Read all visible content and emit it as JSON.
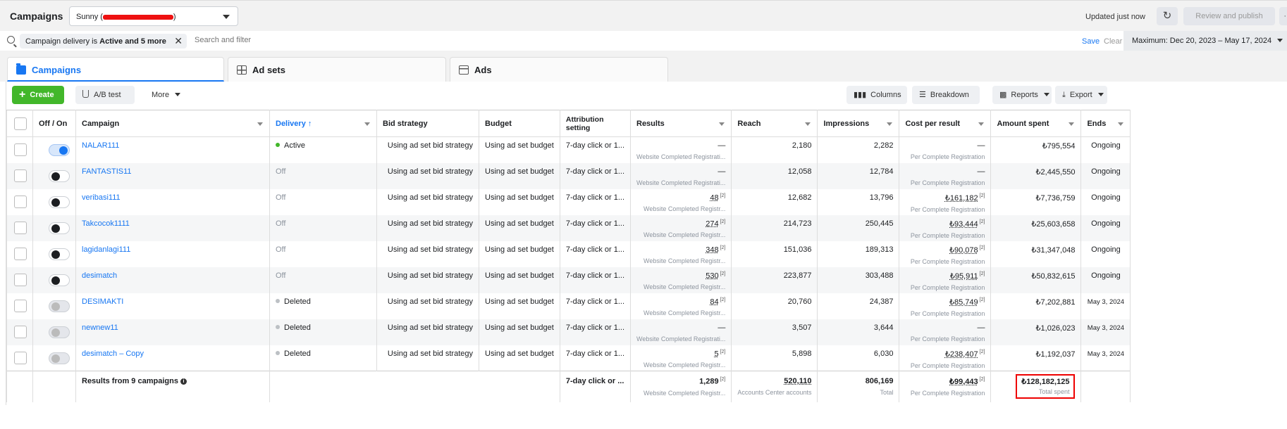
{
  "header": {
    "title": "Campaigns",
    "account": "Sunny (",
    "account_suffix": ")",
    "updated": "Updated just now",
    "review_label": "Review and publish",
    "more_label": "··"
  },
  "filter": {
    "chip_prefix": "Campaign delivery is ",
    "chip_bold": "Active and 5 more",
    "placeholder": "Search and filter",
    "save": "Save",
    "clear": "Clear",
    "date_range": "Maximum: Dec 20, 2023 – May 17, 2024"
  },
  "tabs": [
    {
      "label": "Campaigns",
      "icon": "campaign-icon"
    },
    {
      "label": "Ad sets",
      "icon": "grid-icon"
    },
    {
      "label": "Ads",
      "icon": "ad-icon"
    }
  ],
  "toolbar": {
    "create": "Create",
    "ab_test": "A/B test",
    "more": "More",
    "columns": "Columns",
    "breakdown": "Breakdown",
    "reports": "Reports",
    "export": "Export"
  },
  "columns": {
    "onoff": "Off / On",
    "campaign": "Campaign",
    "delivery": "Delivery ↑",
    "bid": "Bid strategy",
    "budget": "Budget",
    "attribution": "Attribution setting",
    "results": "Results",
    "reach": "Reach",
    "impressions": "Impressions",
    "cpr": "Cost per result",
    "amount": "Amount spent",
    "ends": "Ends"
  },
  "rows": [
    {
      "name": "NALAR111",
      "delivery": "Active",
      "status": "active",
      "bid": "Using ad set bid strategy",
      "budget": "Using ad set budget",
      "attribution": "7-day click or 1...",
      "results": "—",
      "results_sub": "Website Completed Registrati...",
      "reach": "2,180",
      "impressions": "2,282",
      "cpr": "—",
      "cpr_sub": "Per Complete Registration",
      "amount": "₺795,554",
      "ends": "Ongoing",
      "toggle": "on"
    },
    {
      "name": "FANTASTIS11",
      "delivery": "Off",
      "status": "off",
      "bid": "Using ad set bid strategy",
      "budget": "Using ad set budget",
      "attribution": "7-day click or 1...",
      "results": "—",
      "results_sub": "Website Completed Registrati...",
      "reach": "12,058",
      "impressions": "12,784",
      "cpr": "—",
      "cpr_sub": "Per Complete Registration",
      "amount": "₺2,445,550",
      "ends": "Ongoing",
      "toggle": "off"
    },
    {
      "name": "veribasi111",
      "delivery": "Off",
      "status": "off",
      "bid": "Using ad set bid strategy",
      "budget": "Using ad set budget",
      "attribution": "7-day click or 1...",
      "results": "48",
      "results_sup": "[2]",
      "results_sub": "Website Completed Registr...",
      "reach": "12,682",
      "impressions": "13,796",
      "cpr": "₺161,182",
      "cpr_sup": "[2]",
      "cpr_sub": "Per Complete Registration",
      "amount": "₺7,736,759",
      "ends": "Ongoing",
      "toggle": "off"
    },
    {
      "name": "Takcocok1111",
      "delivery": "Off",
      "status": "off",
      "bid": "Using ad set bid strategy",
      "budget": "Using ad set budget",
      "attribution": "7-day click or 1...",
      "results": "274",
      "results_sup": "[2]",
      "results_sub": "Website Completed Registr...",
      "reach": "214,723",
      "impressions": "250,445",
      "cpr": "₺93,444",
      "cpr_sup": "[2]",
      "cpr_sub": "Per Complete Registration",
      "amount": "₺25,603,658",
      "ends": "Ongoing",
      "toggle": "off"
    },
    {
      "name": "lagidanlagi111",
      "delivery": "Off",
      "status": "off",
      "bid": "Using ad set bid strategy",
      "budget": "Using ad set budget",
      "attribution": "7-day click or 1...",
      "results": "348",
      "results_sup": "[2]",
      "results_sub": "Website Completed Registr...",
      "reach": "151,036",
      "impressions": "189,313",
      "cpr": "₺90,078",
      "cpr_sup": "[2]",
      "cpr_sub": "Per Complete Registration",
      "amount": "₺31,347,048",
      "ends": "Ongoing",
      "toggle": "off"
    },
    {
      "name": "desimatch",
      "delivery": "Off",
      "status": "off",
      "bid": "Using ad set bid strategy",
      "budget": "Using ad set budget",
      "attribution": "7-day click or 1...",
      "results": "530",
      "results_sup": "[2]",
      "results_sub": "Website Completed Registr...",
      "reach": "223,877",
      "impressions": "303,488",
      "cpr": "₺95,911",
      "cpr_sup": "[2]",
      "cpr_sub": "Per Complete Registration",
      "amount": "₺50,832,615",
      "ends": "Ongoing",
      "toggle": "off"
    },
    {
      "name": "DESIMAKTI",
      "delivery": "Deleted",
      "status": "deleted",
      "bid": "Using ad set bid strategy",
      "budget": "Using ad set budget",
      "attribution": "7-day click or 1...",
      "results": "84",
      "results_sup": "[2]",
      "results_sub": "Website Completed Registr...",
      "reach": "20,760",
      "impressions": "24,387",
      "cpr": "₺85,749",
      "cpr_sup": "[2]",
      "cpr_sub": "Per Complete Registration",
      "amount": "₺7,202,881",
      "ends": "May 3, 2024",
      "toggle": "disabled"
    },
    {
      "name": "newnew11",
      "delivery": "Deleted",
      "status": "deleted",
      "bid": "Using ad set bid strategy",
      "budget": "Using ad set budget",
      "attribution": "7-day click or 1...",
      "results": "—",
      "results_sub": "Website Completed Registrati...",
      "reach": "3,507",
      "impressions": "3,644",
      "cpr": "—",
      "cpr_sub": "Per Complete Registration",
      "amount": "₺1,026,023",
      "ends": "May 3, 2024",
      "toggle": "disabled"
    },
    {
      "name": "desimatch – Copy",
      "delivery": "Deleted",
      "status": "deleted",
      "bid": "Using ad set bid strategy",
      "budget": "Using ad set budget",
      "attribution": "7-day click or 1...",
      "results": "5",
      "results_sup": "[2]",
      "results_sub": "Website Completed Registr...",
      "reach": "5,898",
      "impressions": "6,030",
      "cpr": "₺238,407",
      "cpr_sup": "[2]",
      "cpr_sub": "Per Complete Registration",
      "amount": "₺1,192,037",
      "ends": "May 3, 2024",
      "toggle": "disabled"
    }
  ],
  "summary": {
    "label": "Results from 9 campaigns",
    "attribution": "7-day click or ...",
    "results": "1,289",
    "results_sup": "[2]",
    "results_sub": "Website Completed Registr...",
    "reach": "520,110",
    "reach_sub": "Accounts Center accounts",
    "impressions": "806,169",
    "impressions_sub": "Total",
    "cpr": "₺99,443",
    "cpr_sup": "[2]",
    "cpr_sub": "Per Complete Registration",
    "amount": "₺128,182,125",
    "amount_sub": "Total spent"
  }
}
